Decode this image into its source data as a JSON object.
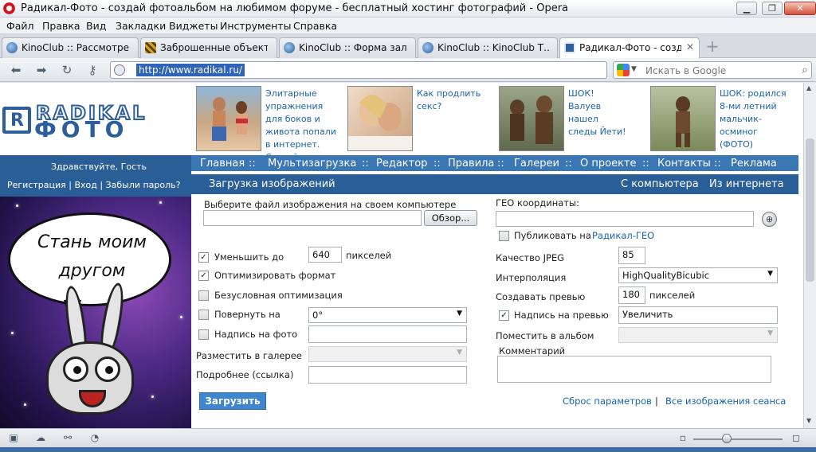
{
  "window": {
    "title": "Радикал-Фото - создай фотоальбом на любимом форуме - бесплатный хостинг фотографий - Opera"
  },
  "menu": [
    "Файл",
    "Правка",
    "Вид",
    "Закладки",
    "Виджеты",
    "Инструменты",
    "Справка"
  ],
  "tabs": [
    {
      "label": "KinoClub :: Рассмотре…",
      "icon": "globe-icon"
    },
    {
      "label": "Заброшенные объект…",
      "icon": "stripe-icon"
    },
    {
      "label": "KinoClub :: Форма зал…",
      "icon": "globe-icon"
    },
    {
      "label": "KinoClub :: KinoClub T…",
      "icon": "globe-icon"
    },
    {
      "label": "Радикал-Фото - созда…",
      "icon": "radikal-icon",
      "active": true
    }
  ],
  "address": {
    "url": "http://www.radikal.ru/",
    "search_placeholder": "Искать в Google"
  },
  "logo": {
    "word1": "RADIKAL",
    "word2": "ФОТО",
    "letter": "R"
  },
  "ads": [
    {
      "text": "Элитарные упражнения для боков и живота попали в интернет. Скачай"
    },
    {
      "text": "Как продлить секс?"
    },
    {
      "text": "ШОК! Валуев нашел следы Йети!"
    },
    {
      "text": "ШОК: родился 8-ми летний мальчик-осминог (ФОТО)"
    }
  ],
  "user": {
    "greeting": "Здравствуйте, Гость",
    "links": "Регистрация  |   Вход  |   Забыли пароль?"
  },
  "nav": [
    "Главная",
    "::",
    "Мультизагрузка",
    "::",
    "Редактор",
    "::",
    "Правила",
    "::",
    "Галереи",
    "::",
    "О проекте",
    "::",
    "Контакты",
    "::",
    "Реклама"
  ],
  "subnav": {
    "title": "Загрузка изображений",
    "from_computer": "С компьютера",
    "from_internet": "Из интернета"
  },
  "banner": {
    "line1": "Стань моим",
    "line2": "другом"
  },
  "form": {
    "choose_file_label": "Выберите файл изображения на своем компьютере",
    "browse_label": "Обзор...",
    "geo_label": "ГЕО координаты:",
    "publish_geo_label": "Публиковать на",
    "publish_geo_link": "Радикал-ГЕО",
    "reduce_label": "Уменьшить до",
    "reduce_value": "640",
    "reduce_unit": "пикселей",
    "optimize_label": "Оптимизировать формат",
    "unconditional_label": "Безусловная оптимизация",
    "rotate_label": "Повернуть на",
    "rotate_value": "0°",
    "caption_label": "Надпись на фото",
    "gallery_label": "Разместить в галерее",
    "more_label": "Подробнее (ссылка)",
    "jpeg_quality_label": "Качество JPEG",
    "jpeg_quality_value": "85",
    "interp_label": "Интерполяция",
    "interp_value": "HighQualityBicubic",
    "preview_label": "Создавать превью",
    "preview_value": "180",
    "preview_unit": "пикселей",
    "preview_caption_label": "Надпись на превью",
    "preview_caption_value": "Увеличить",
    "album_label": "Поместить в альбом",
    "comment_label": "Комментарий",
    "upload_label": "Загрузить",
    "reset_link": "Сброс параметров",
    "separator": "|",
    "all_images_link": "Все изображения сеанса",
    "checks": {
      "reduce": true,
      "optimize": true,
      "unconditional": false,
      "rotate": false,
      "caption": false,
      "publish_geo": false,
      "preview_caption": true
    }
  },
  "colors": {
    "brand": "#2d5e9c",
    "nav": "#3b77b5",
    "link": "#1a63b0"
  }
}
